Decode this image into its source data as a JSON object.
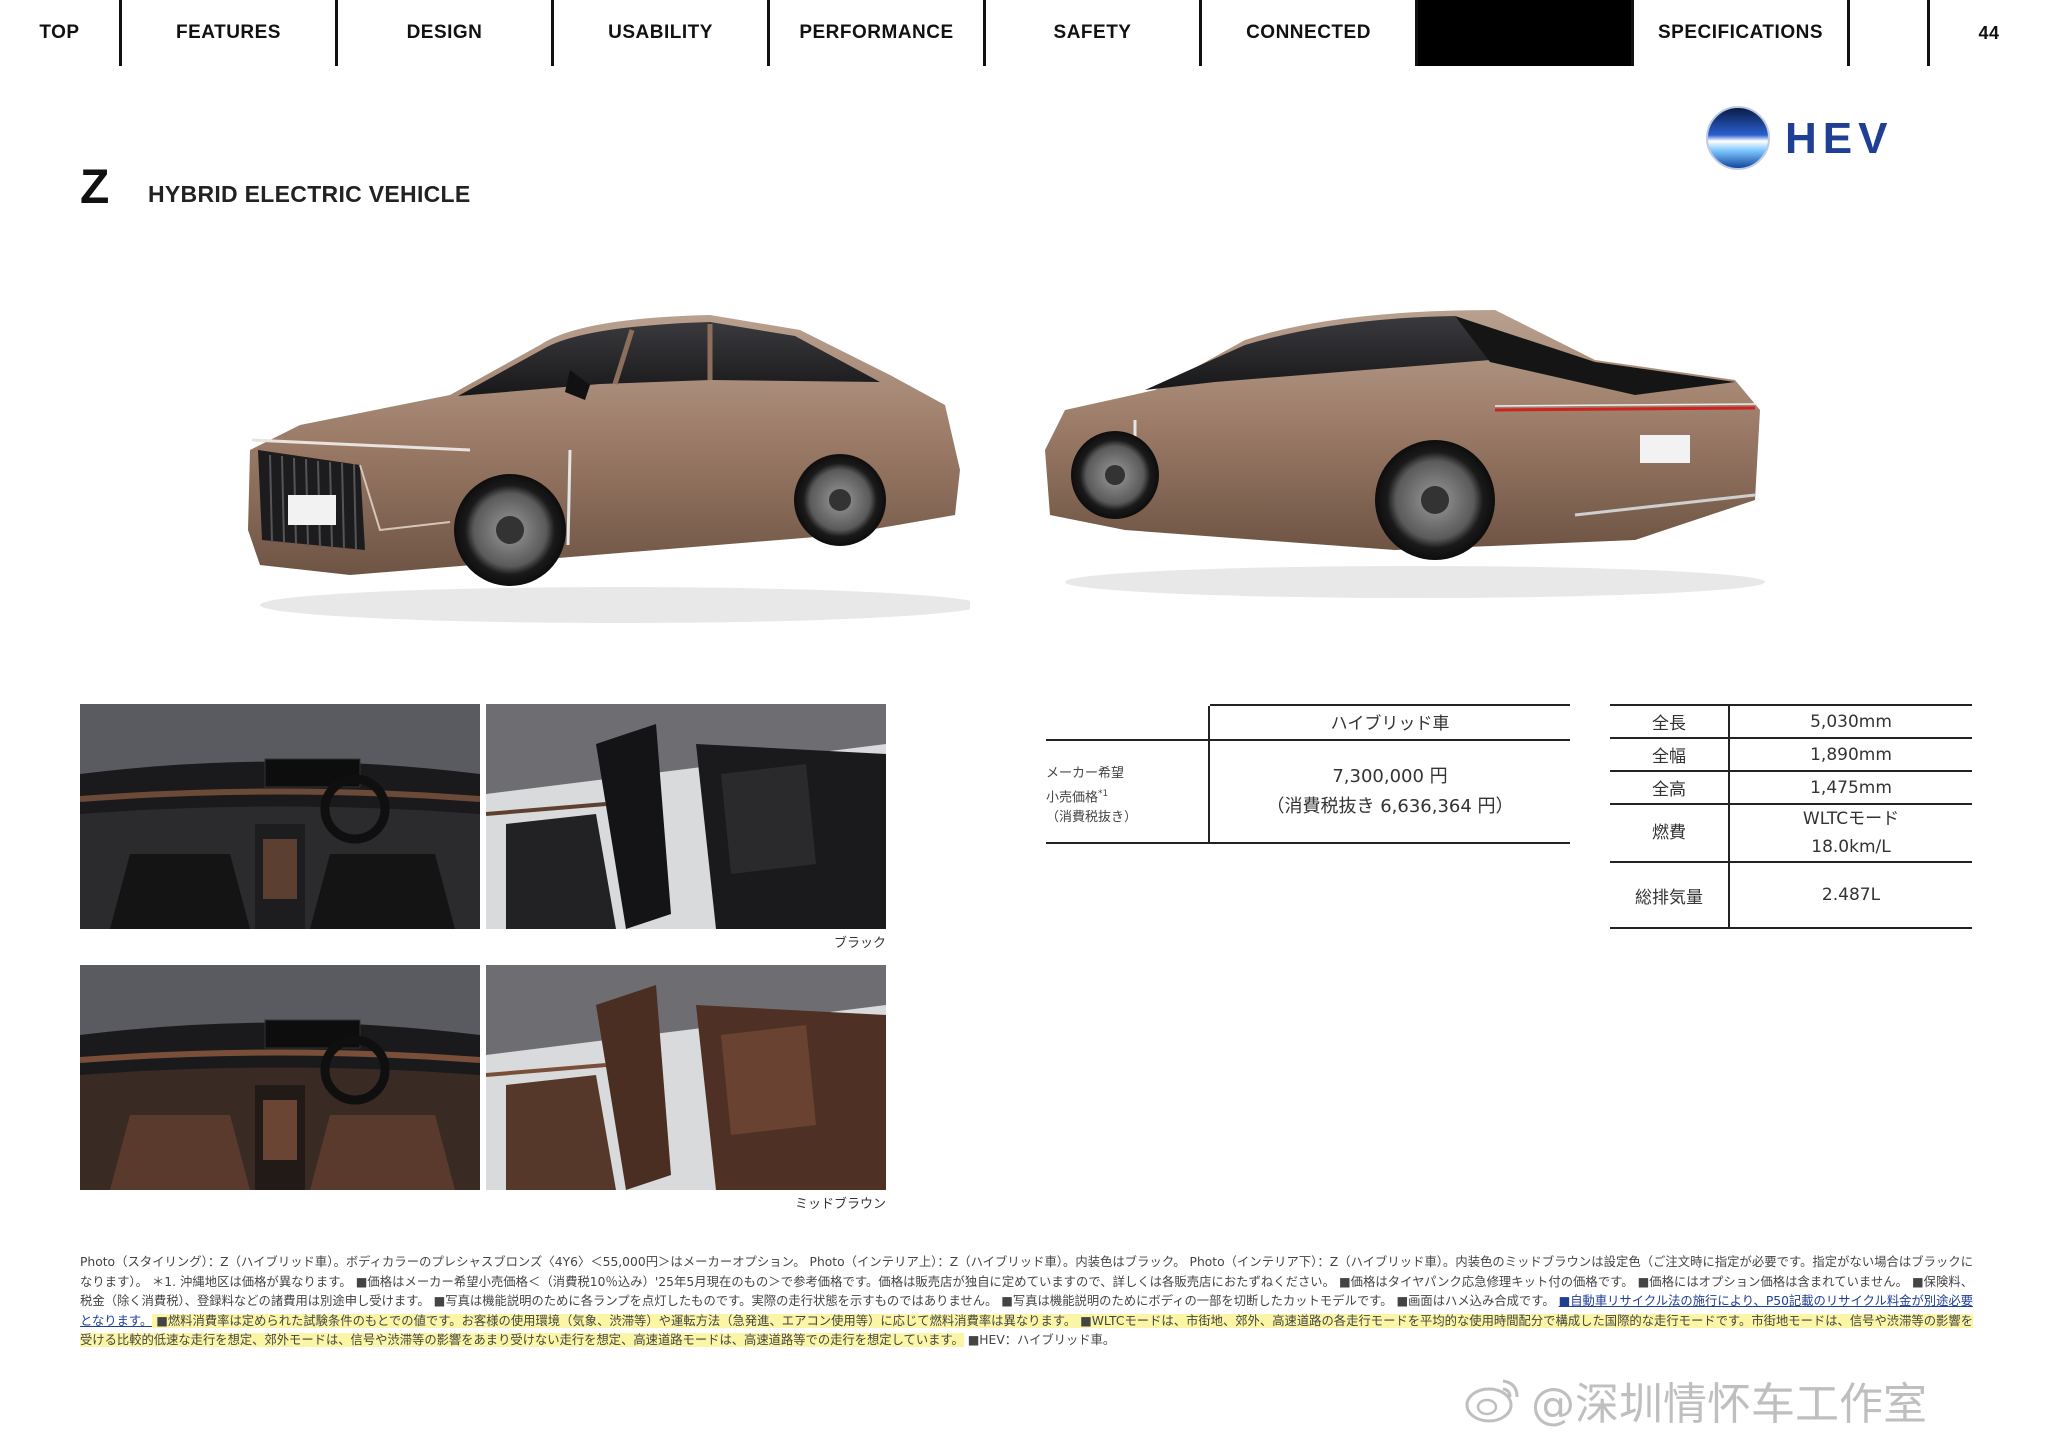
{
  "nav": {
    "items": [
      {
        "label": "TOP",
        "width": 122
      },
      {
        "label": "FEATURES",
        "width": 216
      },
      {
        "label": "DESIGN",
        "width": 216
      },
      {
        "label": "USABILITY",
        "width": 216
      },
      {
        "label": "PERFORMANCE",
        "width": 216
      },
      {
        "label": "SAFETY",
        "width": 216
      },
      {
        "label": "CONNECTED",
        "width": 216
      },
      {
        "label": "",
        "width": 216
      },
      {
        "label": "SPECIFICATIONS",
        "width": 216
      },
      {
        "label": "",
        "width": 80
      }
    ],
    "page_number": "44"
  },
  "logo": {
    "text": "HEV"
  },
  "grade": {
    "letter": "Z",
    "name": "HYBRID ELECTRIC VEHICLE"
  },
  "photos": {
    "caption_black": "ブラック",
    "caption_brown": "ミッドブラウン"
  },
  "price": {
    "header": "ハイブリッド車",
    "label_line1": "メーカー希望",
    "label_line2": "小売価格",
    "label_mark": "*1",
    "label_line3": "（消費税抜き）",
    "value": "7,300,000 円",
    "value_ex_tax": "（消費税抜き 6,636,364 円）"
  },
  "specs": [
    {
      "key": "全長",
      "value": "5,030mm"
    },
    {
      "key": "全幅",
      "value": "1,890mm"
    },
    {
      "key": "全高",
      "value": "1,475mm"
    },
    {
      "key": "燃費",
      "value": "WLTCモード",
      "value2": "18.0km/L"
    },
    {
      "key": "総排気量",
      "value": "2.487L"
    }
  ],
  "notes": {
    "p1": "Photo（スタイリング）：Z（ハイブリッド車）。ボディカラーのプレシャスブロンズ〈4Y6〉＜55,000円＞はメーカーオプション。 Photo（インテリア上）：Z（ハイブリッド車）。内装色はブラック。 Photo（インテリア下）：Z（ハイブリッド車）。内装色のミッドブラウンは設定色（ご注文時に指定が必要です。指定がない場合はブラックになります）。 ＊1. 沖縄地区は価格が異なります。 ■価格はメーカー希望小売価格＜（消費税10％込み）'25年5月現在のもの＞で参考価格です。価格は販売店が独自に定めていますので、詳しくは各販売店におたずねください。 ■価格はタイヤパンク応急修理キット付の価格です。 ■価格にはオプション価格は含まれていません。 ■保険料、税金（除く消費税）、登録料などの諸費用は別途申し受けます。 ■写真は機能説明のために各ランプを点灯したものです。実際の走行状態を示すものではありません。 ■写真は機能説明のためにボディの一部を切断したカットモデルです。 ■画面はハメ込み合成です。 ",
    "p2": "■自動車リサイクル法の施行により、P50記載のリサイクル料金が別途必要となります。",
    "p3": " ■燃料消費率は定められた試験条件のもとでの値です。お客様の使用環境（気象、渋滞等）や運転方法（急発進、エアコン使用等）に応じて燃料消費率は異なります。 ■WLTCモードは、市街地、郊外、高速道路の各走行モードを平均的な使用時間配分で構成した国際的な走行モードです。市街地モードは、信号や渋滞等の影響を受ける比較的低速な走行を想定、郊外モードは、信号や渋滞等の影響をあまり受けない走行を想定、高速道路モードは、高速道路等での走行を想定しています。",
    "p4": " ■HEV：ハイブリッド車。"
  },
  "watermark": {
    "text": "@深圳情怀车工作室"
  },
  "colors": {
    "body_paint": "#9a7a66",
    "interior_black": "#1e1e20",
    "interior_brown": "#5a3a2c",
    "accent_blue": "#1f3f95"
  }
}
